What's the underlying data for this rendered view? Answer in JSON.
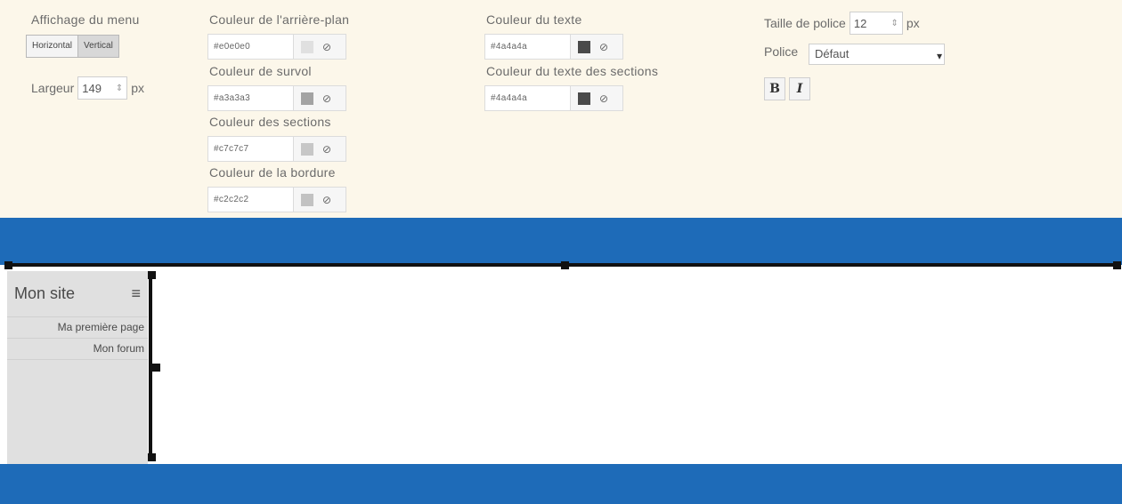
{
  "menu_display": {
    "title": "Affichage du menu",
    "options": [
      "Horizontal",
      "Vertical"
    ],
    "selected": "Vertical",
    "width_label": "Largeur",
    "width_value": "149",
    "width_unit": "px"
  },
  "bg_color": {
    "title": "Couleur de l'arrière-plan",
    "hex": "#e0e0e0",
    "swatch": "#e0e0e0"
  },
  "hover_color": {
    "title": "Couleur de survol",
    "hex": "#a3a3a3",
    "swatch": "#a3a3a3"
  },
  "section_color": {
    "title": "Couleur des sections",
    "hex": "#c7c7c7",
    "swatch": "#c7c7c7"
  },
  "border_color": {
    "title": "Couleur de la bordure",
    "hex": "#c2c2c2",
    "swatch": "#c2c2c2"
  },
  "text_color": {
    "title": "Couleur du texte",
    "hex": "#4a4a4a",
    "swatch": "#4a4a4a"
  },
  "section_text_color": {
    "title": "Couleur du texte des sections",
    "hex": "#4a4a4a",
    "swatch": "#4a4a4a"
  },
  "font_settings": {
    "size_label": "Taille de police",
    "size_value": "12",
    "size_unit": "px",
    "font_label": "Police",
    "font_value": "Défaut",
    "bold_label": "B",
    "italic_label": "I"
  },
  "preview_menu": {
    "site_name": "Mon site",
    "items": [
      "Ma première page",
      "Mon forum"
    ]
  },
  "colors": {
    "band": "#1e6bb8",
    "settings_bg": "#fcf7ea"
  },
  "icons": {
    "clear": "⊘",
    "spinner": "⇕",
    "hamburger": "≡",
    "caret": "▾"
  }
}
